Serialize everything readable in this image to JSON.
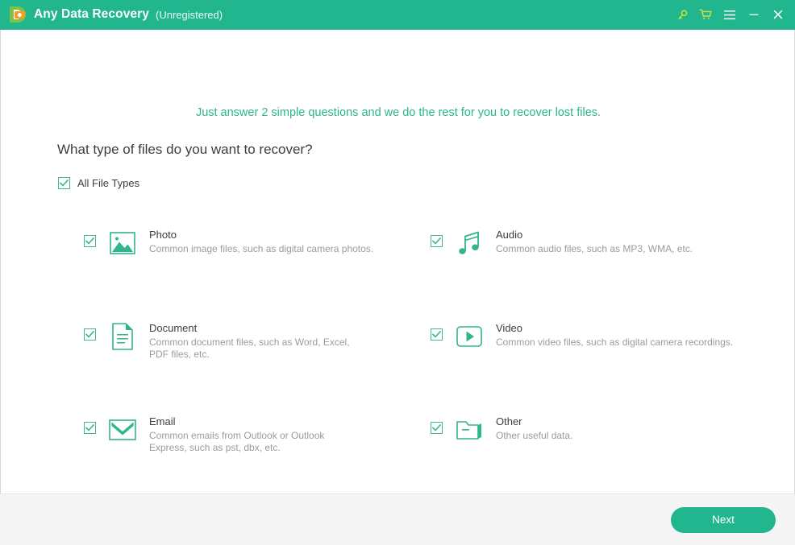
{
  "titlebar": {
    "app_name": "Any Data Recovery",
    "registration_status": "(Unregistered)",
    "logo_icon": "app-logo-icon",
    "icons": [
      {
        "name": "key-icon",
        "label": "Register"
      },
      {
        "name": "cart-icon",
        "label": "Buy"
      },
      {
        "name": "hamburger-menu-icon",
        "label": "Menu"
      },
      {
        "name": "minimize-icon",
        "label": "Minimize"
      },
      {
        "name": "close-icon",
        "label": "Close"
      }
    ],
    "colors": {
      "bar": "#22b68f",
      "accent_yellow": "#d8e633",
      "text": "#ffffff"
    }
  },
  "main": {
    "tagline": "Just answer 2 simple questions and we do the rest for you to recover lost files.",
    "question": "What type of files do you want to recover?",
    "all_file_types": {
      "label": "All File Types",
      "checked": true
    },
    "file_types": [
      {
        "id": "photo",
        "title": "Photo",
        "description": "Common image files, such as digital camera photos.",
        "icon": "photo-icon",
        "checked": true
      },
      {
        "id": "audio",
        "title": "Audio",
        "description": "Common audio files, such as MP3, WMA, etc.",
        "icon": "audio-icon",
        "checked": true
      },
      {
        "id": "document",
        "title": "Document",
        "description": "Common document files, such as Word, Excel, PDF files, etc.",
        "icon": "document-icon",
        "checked": true
      },
      {
        "id": "video",
        "title": "Video",
        "description": "Common video files, such as digital camera recordings.",
        "icon": "video-icon",
        "checked": true
      },
      {
        "id": "email",
        "title": "Email",
        "description": "Common emails from Outlook or Outlook Express, such as pst, dbx, etc.",
        "icon": "email-icon",
        "checked": true
      },
      {
        "id": "other",
        "title": "Other",
        "description": "Other useful data.",
        "icon": "other-folder-icon",
        "checked": true
      }
    ]
  },
  "footer": {
    "next_label": "Next"
  },
  "colors": {
    "brand_green": "#22b68f",
    "icon_green": "#2fb68c",
    "tagline_green": "#2bb58e",
    "body_text": "#3d3d3d",
    "muted_text": "#9b9b9b",
    "footer_bg": "#f5f5f5"
  }
}
